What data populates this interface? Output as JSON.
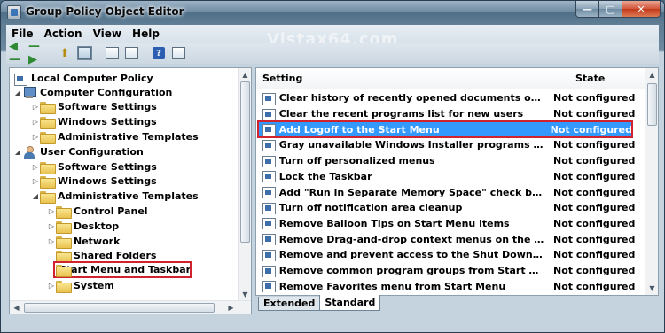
{
  "window": {
    "title": "Group Policy Object Editor"
  },
  "watermark": "Vistax64.com",
  "menu": {
    "file": "File",
    "action": "Action",
    "view": "View",
    "help": "Help"
  },
  "toolbar": {
    "help_label": "?"
  },
  "tree": {
    "root": "Local Computer Policy",
    "items": [
      {
        "label": "Computer Configuration"
      },
      {
        "label": "Software Settings"
      },
      {
        "label": "Windows Settings"
      },
      {
        "label": "Administrative Templates"
      },
      {
        "label": "User Configuration"
      },
      {
        "label": "Software Settings"
      },
      {
        "label": "Windows Settings"
      },
      {
        "label": "Administrative Templates"
      },
      {
        "label": "Control Panel"
      },
      {
        "label": "Desktop"
      },
      {
        "label": "Network"
      },
      {
        "label": "Shared Folders"
      },
      {
        "label": "Start Menu and Taskbar"
      },
      {
        "label": "System"
      }
    ]
  },
  "list": {
    "columns": {
      "setting": "Setting",
      "state": "State"
    },
    "rows": [
      {
        "setting": "Clear history of recently opened documents on exit",
        "state": "Not configured"
      },
      {
        "setting": "Clear the recent programs list for new users",
        "state": "Not configured"
      },
      {
        "setting": "Add Logoff to the Start Menu",
        "state": "Not configured"
      },
      {
        "setting": "Gray unavailable Windows Installer programs Start Menu...",
        "state": "Not configured"
      },
      {
        "setting": "Turn off personalized menus",
        "state": "Not configured"
      },
      {
        "setting": "Lock the Taskbar",
        "state": "Not configured"
      },
      {
        "setting": "Add \"Run in Separate Memory Space\" check box to Run ...",
        "state": "Not configured"
      },
      {
        "setting": "Turn off notification area cleanup",
        "state": "Not configured"
      },
      {
        "setting": "Remove Balloon Tips on Start Menu items",
        "state": "Not configured"
      },
      {
        "setting": "Remove Drag-and-drop context menus on the Start Menu",
        "state": "Not configured"
      },
      {
        "setting": "Remove and prevent access to the Shut Down, Restart, ...",
        "state": "Not configured"
      },
      {
        "setting": "Remove common program groups from Start Menu",
        "state": "Not configured"
      },
      {
        "setting": "Remove Favorites menu from Start Menu",
        "state": "Not configured"
      }
    ]
  },
  "tabs": {
    "extended": "Extended",
    "standard": "Standard"
  }
}
